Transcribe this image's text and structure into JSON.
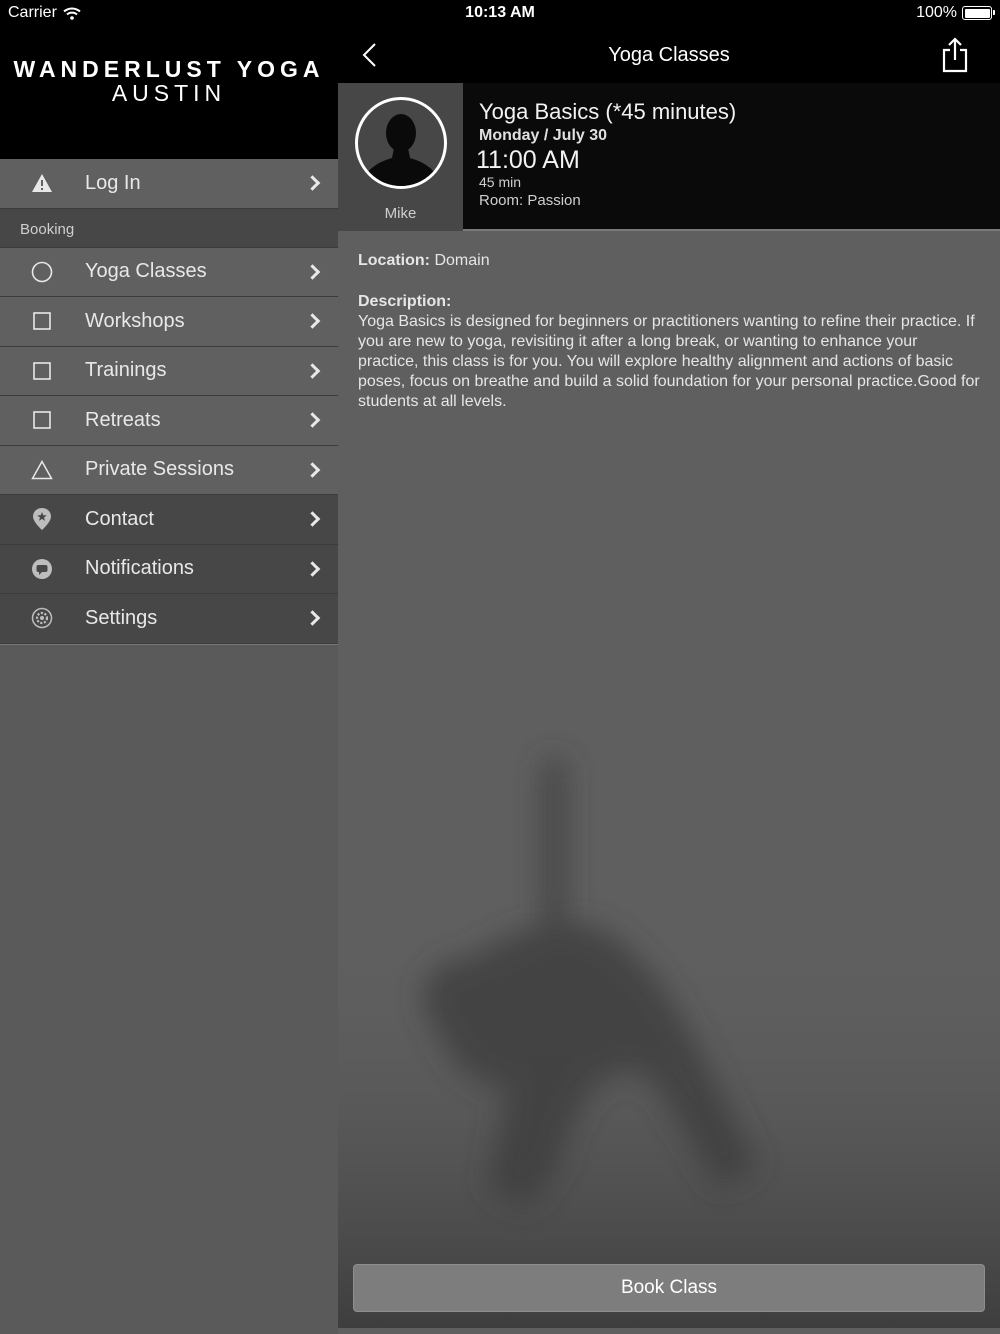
{
  "status_bar": {
    "carrier": "Carrier",
    "time": "10:13 AM",
    "battery": "100%"
  },
  "brand": {
    "line1": "WANDERLUST YOGA",
    "line2": "AUSTIN"
  },
  "sidebar": {
    "login": {
      "label": "Log In",
      "icon": "warning-icon"
    },
    "section_header": "Booking",
    "booking_items": [
      {
        "label": "Yoga Classes",
        "icon": "circle-icon"
      },
      {
        "label": "Workshops",
        "icon": "square-icon"
      },
      {
        "label": "Trainings",
        "icon": "square-icon"
      },
      {
        "label": "Retreats",
        "icon": "square-icon"
      },
      {
        "label": "Private Sessions",
        "icon": "triangle-icon"
      }
    ],
    "other_items": [
      {
        "label": "Contact",
        "icon": "location-pin-icon"
      },
      {
        "label": "Notifications",
        "icon": "chat-bubble-icon"
      },
      {
        "label": "Settings",
        "icon": "gear-icon"
      }
    ]
  },
  "navbar": {
    "title": "Yoga Classes"
  },
  "class": {
    "instructor": "Mike",
    "title": "Yoga Basics (*45 minutes)",
    "date": "Monday / July 30",
    "time": "11:00 AM",
    "duration": "45 min",
    "room": "Room: Passion",
    "location_label": "Location:",
    "location_value": "Domain",
    "description_label": "Description:",
    "description": "Yoga Basics is designed for beginners or practitioners wanting to refine their practice. If you are new to yoga, revisiting it after a long break, or wanting to enhance your practice, this class is for you. You will explore healthy alignment and actions of basic poses, focus on breathe and build a solid foundation for your personal practice.Good for students at all levels."
  },
  "book_button": "Book Class"
}
